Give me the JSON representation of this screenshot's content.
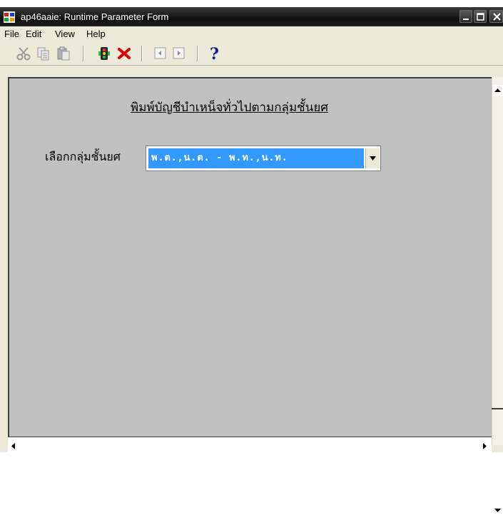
{
  "window": {
    "title": "ap46aaie: Runtime Parameter Form"
  },
  "menu": {
    "items": [
      "File",
      "Edit",
      "View",
      "Help"
    ]
  },
  "toolbar": {
    "icons": [
      "cut-icon",
      "copy-icon",
      "paste-icon",
      "run-icon",
      "cancel-icon",
      "prev-icon",
      "next-icon",
      "help-icon"
    ]
  },
  "form": {
    "heading": "พิมพ์บัญชีบำเหน็จทั่วไปตามกลุ่มชั้นยศ",
    "field_label": "เลือกกลุ่มชั้นยศ",
    "selected_value": "พ.ต.,น.ต. - พ.ท.,น.ท."
  },
  "colors": {
    "titlebar": "#111111",
    "form_background": "#c0c0c0",
    "selection": "#3399ff"
  }
}
